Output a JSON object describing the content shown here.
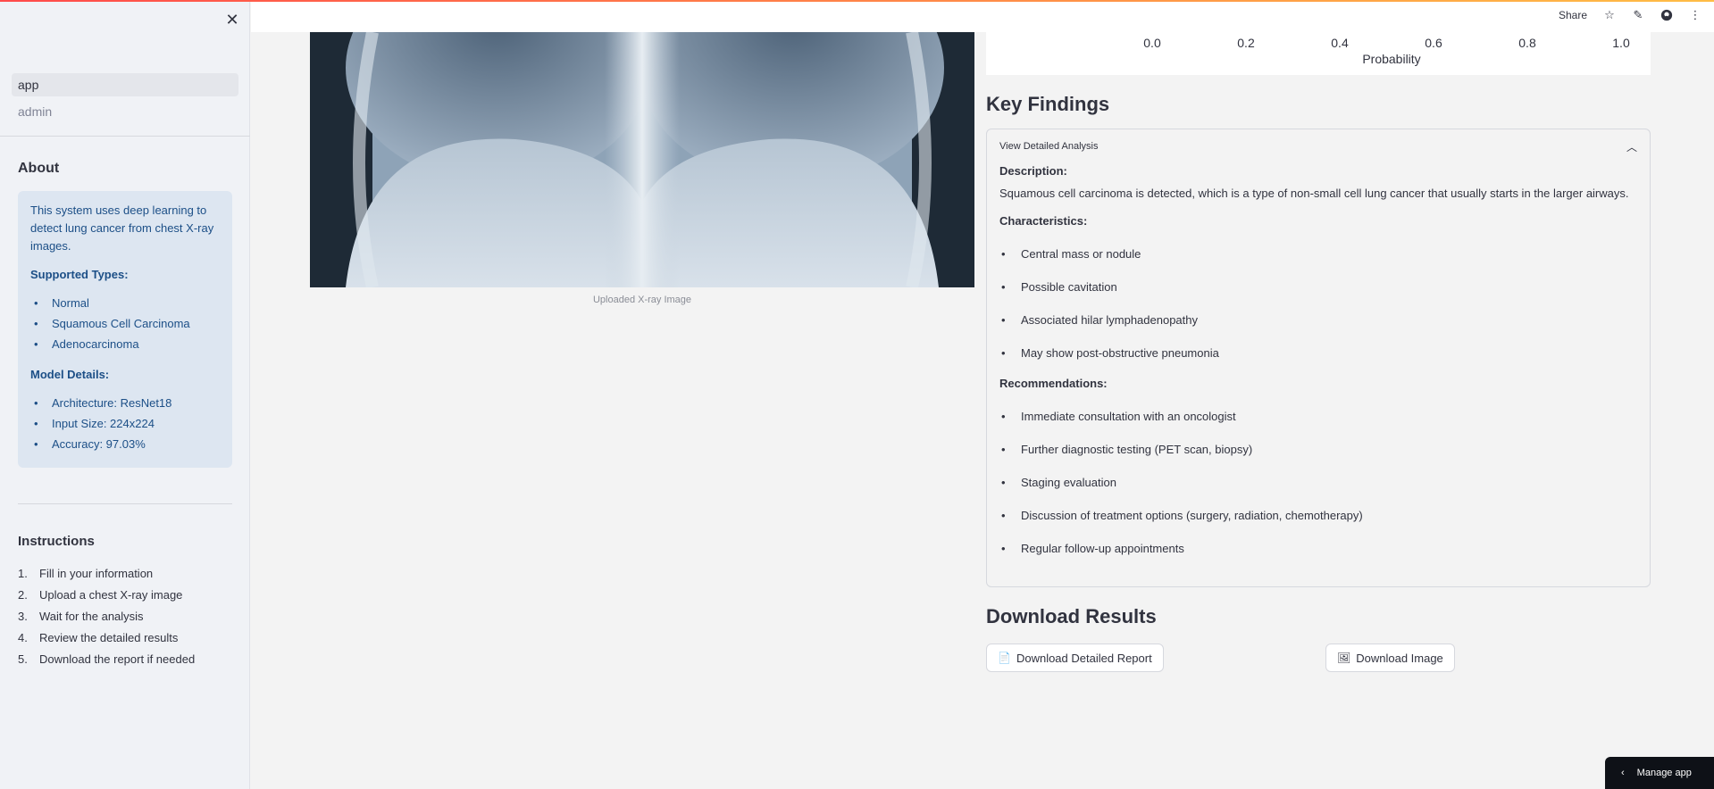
{
  "sidebar": {
    "nav": [
      {
        "label": "app",
        "active": true
      },
      {
        "label": "admin",
        "active": false
      }
    ],
    "about": {
      "title": "About",
      "intro": "This system uses deep learning to detect lung cancer from chest X-ray images.",
      "supported_title": "Supported Types:",
      "supported": [
        "Normal",
        "Squamous Cell Carcinoma",
        "Adenocarcinoma"
      ],
      "model_title": "Model Details:",
      "model": [
        "Architecture: ResNet18",
        "Input Size: 224x224",
        "Accuracy: 97.03%"
      ]
    },
    "instructions": {
      "title": "Instructions",
      "steps": [
        {
          "num": "1.",
          "text": "Fill in your information"
        },
        {
          "num": "2.",
          "text": "Upload a chest X-ray image"
        },
        {
          "num": "3.",
          "text": "Wait for the analysis"
        },
        {
          "num": "4.",
          "text": "Review the detailed results"
        },
        {
          "num": "5.",
          "text": "Download the report if needed"
        }
      ]
    }
  },
  "header": {
    "share_label": "Share"
  },
  "image": {
    "caption": "Uploaded X-ray Image"
  },
  "chart": {
    "ticks": [
      "0.0",
      "0.2",
      "0.4",
      "0.6",
      "0.8",
      "1.0"
    ],
    "xlabel": "Probability"
  },
  "findings": {
    "title": "Key Findings",
    "expander_label": "View Detailed Analysis",
    "description_label": "Description:",
    "description": "Squamous cell carcinoma is detected, which is a type of non-small cell lung cancer that usually starts in the larger airways.",
    "characteristics_label": "Characteristics:",
    "characteristics": [
      "Central mass or nodule",
      "Possible cavitation",
      "Associated hilar lymphadenopathy",
      "May show post-obstructive pneumonia"
    ],
    "recommendations_label": "Recommendations:",
    "recommendations": [
      "Immediate consultation with an oncologist",
      "Further diagnostic testing (PET scan, biopsy)",
      "Staging evaluation",
      "Discussion of treatment options (surgery, radiation, chemotherapy)",
      "Regular follow-up appointments"
    ]
  },
  "download": {
    "title": "Download Results",
    "report_label": "Download Detailed Report",
    "image_label": "Download Image"
  },
  "manage_app": {
    "label": "Manage app"
  }
}
